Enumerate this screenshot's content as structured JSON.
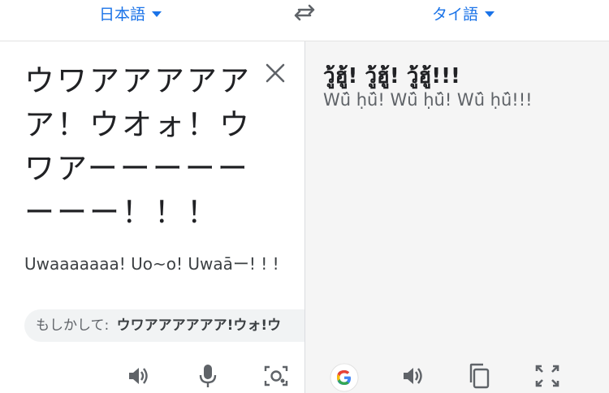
{
  "header": {
    "source_language": "日本語",
    "target_language": "タイ語"
  },
  "source": {
    "text": "ウワアアアアアア！ウオォ！ウワアーーーーーーーー！！！",
    "romanization": "Uwaaaaaaa! Uo~o! Uwaāー! ! !",
    "suggestion_label": "もしかして:",
    "suggestion_text": "ウワアアアアアア!ウォ!ウ"
  },
  "target": {
    "text": "วู้ฮู้! วู้ฮู้! วู้ฮู้!!!",
    "transliteration": "Wū̂ ḥū̂! Wū̂ ḥū̂! Wū̂ ḥū̂!!!"
  },
  "icons": {
    "source_toolbar": [
      "speaker-icon",
      "mic-icon",
      "camera-icon"
    ],
    "target_toolbar": [
      "google-icon",
      "speaker-icon",
      "copy-icon",
      "fullscreen-icon"
    ]
  },
  "colors": {
    "accent": "#1a73e8",
    "google_blue": "#4285f4",
    "google_red": "#ea4335",
    "google_yellow": "#fbbc05",
    "google_green": "#34a853"
  }
}
